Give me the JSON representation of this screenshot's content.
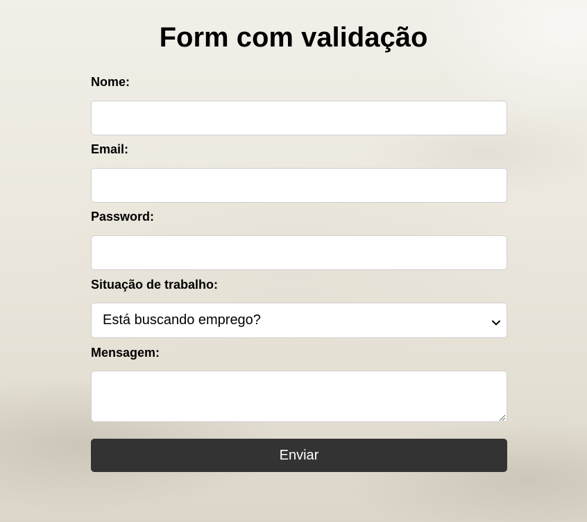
{
  "page": {
    "title": "Form com validação"
  },
  "form": {
    "name_label": "Nome:",
    "name_value": "",
    "email_label": "Email:",
    "email_value": "",
    "password_label": "Password:",
    "password_value": "",
    "work_label": "Situação de trabalho:",
    "work_selected": "Está buscando emprego?",
    "message_label": "Mensagem:",
    "message_value": "",
    "submit_label": "Enviar"
  },
  "colors": {
    "button_bg": "#333333",
    "button_text": "#ffffff",
    "field_border": "#cfcfcf"
  }
}
